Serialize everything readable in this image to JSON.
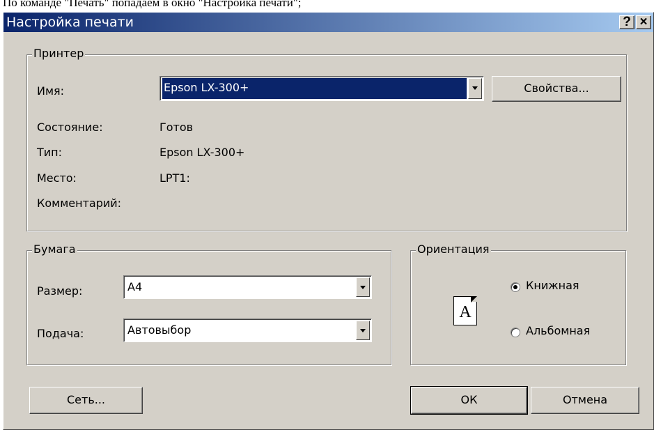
{
  "caption": "По команде \"Печать\" попадаем в окно \"Настройка печати\";",
  "window": {
    "title": "Настройка печати",
    "help_glyph": "?",
    "close_glyph": "×"
  },
  "printer": {
    "group_label": "Принтер",
    "name_label": "Имя:",
    "name_value": "Epson LX-300+",
    "properties_button": "Свойства...",
    "status_label": "Состояние:",
    "status_value": "Готов",
    "type_label": "Тип:",
    "type_value": "Epson LX-300+",
    "location_label": "Место:",
    "location_value": "LPT1:",
    "comment_label": "Комментарий:",
    "comment_value": ""
  },
  "paper": {
    "group_label": "Бумага",
    "size_label": "Размер:",
    "size_value": "A4",
    "source_label": "Подача:",
    "source_value": "Автовыбор"
  },
  "orientation": {
    "group_label": "Ориентация",
    "page_glyph": "A",
    "portrait_label": "Книжная",
    "landscape_label": "Альбомная",
    "selected": "portrait"
  },
  "buttons": {
    "network": "Сеть...",
    "ok": "ОК",
    "cancel": "Отмена"
  },
  "icons": {
    "dropdown": "chevron-down-icon",
    "help": "help-icon",
    "close": "close-icon",
    "page": "page-portrait-icon"
  },
  "colors": {
    "face": "#d4d0c8",
    "title_start": "#0a246a",
    "title_end": "#a6caf0",
    "selection": "#0a246a"
  }
}
